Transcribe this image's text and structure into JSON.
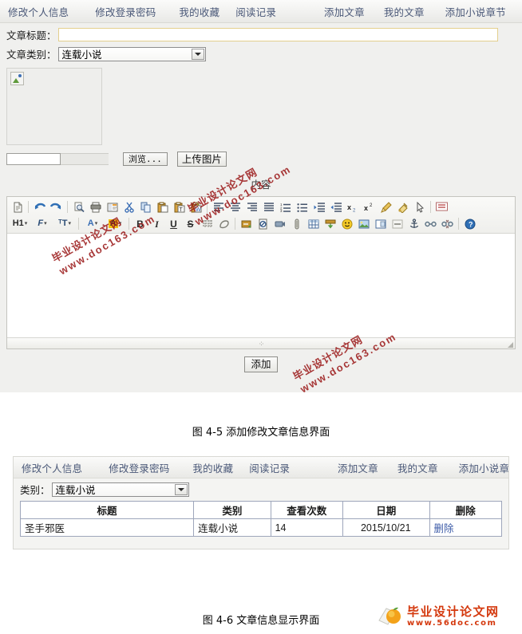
{
  "nav": {
    "items": [
      {
        "label": "修改个人信息",
        "name": "nav-edit-profile"
      },
      {
        "label": "修改登录密码",
        "name": "nav-change-password"
      },
      {
        "label": "我的收藏",
        "name": "nav-my-favorites"
      },
      {
        "label": "阅读记录",
        "name": "nav-reading-history"
      },
      {
        "label": "添加文章",
        "name": "nav-add-article"
      },
      {
        "label": "我的文章",
        "name": "nav-my-articles"
      },
      {
        "label": "添加小说章节",
        "name": "nav-add-novel-chapter"
      }
    ]
  },
  "form": {
    "title_label": "文章标题：",
    "title_value": "",
    "title_placeholder": "",
    "category_label": "文章类别：",
    "category_value": "连载小说",
    "category_options": [
      "连载小说"
    ],
    "file_value": "",
    "browse_label": "浏览...",
    "upload_label": "上传图片",
    "content_label": "内容",
    "editor_value": "",
    "submit_label": "添加"
  },
  "toolbar": {
    "row1": [
      {
        "name": "new-page-icon",
        "glyph": "new-page"
      },
      {
        "name": "separator",
        "glyph": "sep"
      },
      {
        "name": "undo-icon",
        "glyph": "undo"
      },
      {
        "name": "redo-icon",
        "glyph": "redo"
      },
      {
        "name": "separator",
        "glyph": "sep"
      },
      {
        "name": "preview-icon",
        "glyph": "preview"
      },
      {
        "name": "print-icon",
        "glyph": "print"
      },
      {
        "name": "templates-icon",
        "glyph": "templates"
      },
      {
        "name": "cut-icon",
        "glyph": "cut"
      },
      {
        "name": "copy-icon",
        "glyph": "copy"
      },
      {
        "name": "paste-icon",
        "glyph": "paste"
      },
      {
        "name": "paste-text-icon",
        "glyph": "paste-text"
      },
      {
        "name": "paste-word-icon",
        "glyph": "paste-word"
      },
      {
        "name": "separator",
        "glyph": "sep"
      },
      {
        "name": "align-left-icon",
        "glyph": "align-left"
      },
      {
        "name": "align-center-icon",
        "glyph": "align-center"
      },
      {
        "name": "align-right-icon",
        "glyph": "align-right"
      },
      {
        "name": "align-justify-icon",
        "glyph": "align-justify"
      },
      {
        "name": "numbered-list-icon",
        "glyph": "ol"
      },
      {
        "name": "bulleted-list-icon",
        "glyph": "ul"
      },
      {
        "name": "indent-icon",
        "glyph": "indent"
      },
      {
        "name": "outdent-icon",
        "glyph": "outdent"
      },
      {
        "name": "subscript-icon",
        "glyph": "sub"
      },
      {
        "name": "superscript-icon",
        "glyph": "sup"
      },
      {
        "name": "remove-format-icon",
        "glyph": "brush"
      },
      {
        "name": "format-painter-icon",
        "glyph": "painter"
      },
      {
        "name": "select-all-icon",
        "glyph": "cursor"
      },
      {
        "name": "separator",
        "glyph": "sep"
      },
      {
        "name": "show-blocks-icon",
        "glyph": "blocks"
      }
    ],
    "row2": [
      {
        "name": "heading-select",
        "glyph": "text",
        "text": "H1"
      },
      {
        "name": "font-family-select",
        "glyph": "text",
        "text": "Ƒ"
      },
      {
        "name": "font-size-select",
        "glyph": "text",
        "text": "ᴛT"
      },
      {
        "name": "separator",
        "glyph": "sep"
      },
      {
        "name": "text-color-button",
        "glyph": "text-color",
        "text": "A"
      },
      {
        "name": "background-color-button",
        "glyph": "bg-color",
        "text": "A"
      },
      {
        "name": "separator",
        "glyph": "sep"
      },
      {
        "name": "bold-button",
        "glyph": "text",
        "text": "B"
      },
      {
        "name": "italic-button",
        "glyph": "text",
        "text": "I"
      },
      {
        "name": "underline-button",
        "glyph": "text",
        "text": "U"
      },
      {
        "name": "strike-button",
        "glyph": "text",
        "text": "S"
      },
      {
        "name": "show-grid-icon",
        "glyph": "grid"
      },
      {
        "name": "eraser-icon",
        "glyph": "eraser"
      },
      {
        "name": "separator",
        "glyph": "sep"
      },
      {
        "name": "insert-media-icon",
        "glyph": "media"
      },
      {
        "name": "page-break-icon",
        "glyph": "pagebreak"
      },
      {
        "name": "insert-flash-icon",
        "glyph": "flash"
      },
      {
        "name": "attachment-icon",
        "glyph": "clip"
      },
      {
        "name": "insert-table-icon",
        "glyph": "table"
      },
      {
        "name": "insert-template-icon",
        "glyph": "greenbar"
      },
      {
        "name": "smiley-icon",
        "glyph": "smiley"
      },
      {
        "name": "insert-image-icon",
        "glyph": "image"
      },
      {
        "name": "insert-frame-icon",
        "glyph": "frame"
      },
      {
        "name": "horizontal-rule-icon",
        "glyph": "hr"
      },
      {
        "name": "anchor-icon",
        "glyph": "anchor"
      },
      {
        "name": "link-icon",
        "glyph": "link"
      },
      {
        "name": "unlink-icon",
        "glyph": "unlink"
      },
      {
        "name": "separator",
        "glyph": "sep"
      },
      {
        "name": "help-icon",
        "glyph": "help"
      }
    ]
  },
  "watermarks": [
    {
      "line1": "毕业设计论文网",
      "line2": "www.doc163.com"
    },
    {
      "line1": "毕业设计论文网",
      "line2": "www.doc163.com"
    },
    {
      "line1": "毕业设计论文网",
      "line2": "www.doc163.com"
    }
  ],
  "captions": {
    "figure_4_5": "图 4-5 添加修改文章信息界面",
    "figure_4_6": "图 4-6 文章信息显示界面"
  },
  "list_panel": {
    "category_label": "类别：",
    "category_value": "连载小说",
    "columns": [
      "标题",
      "类别",
      "查看次数",
      "日期",
      "删除"
    ],
    "rows": [
      {
        "title": "圣手邪医",
        "category": "连载小说",
        "views": "14",
        "date": "2015/10/21",
        "delete_label": "删除"
      }
    ]
  },
  "logo": {
    "name_cn": "毕业设计论文网",
    "url": "www.56doc.com",
    "color": "#d4380d"
  }
}
